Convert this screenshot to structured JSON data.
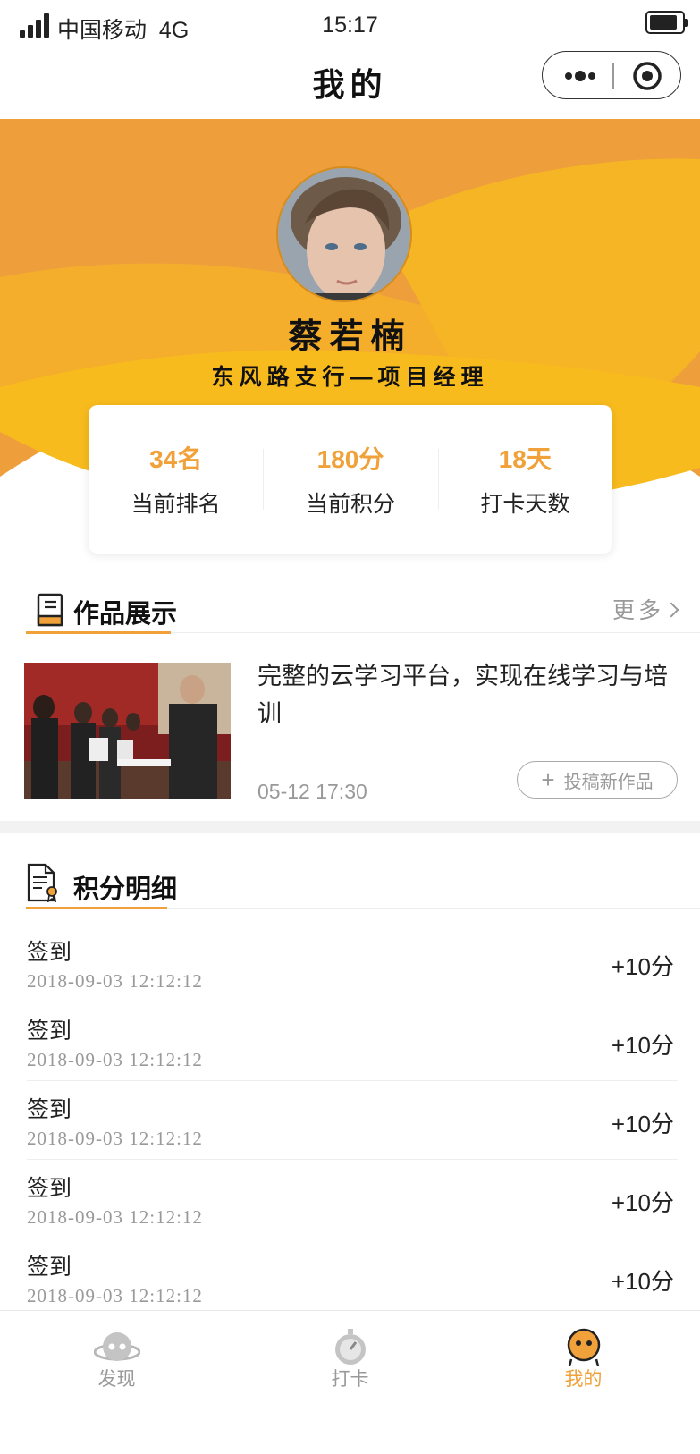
{
  "status_bar": {
    "carrier": "中国移动",
    "network": "4G",
    "time": "15:17"
  },
  "nav": {
    "title": "我的"
  },
  "profile": {
    "name": "蔡若楠",
    "title": "东风路支行—项目经理"
  },
  "stats": [
    {
      "value": "34名",
      "label": "当前排名"
    },
    {
      "value": "180分",
      "label": "当前积分"
    },
    {
      "value": "18天",
      "label": "打卡天数"
    }
  ],
  "works_section": {
    "title": "作品展示",
    "more_label": "更多",
    "item": {
      "title": "完整的云学习平台，实现在线学习与培训",
      "time": "05-12  17:30"
    },
    "submit_label": "投稿新作品"
  },
  "points_section": {
    "title": "积分明细",
    "items": [
      {
        "type": "签到",
        "date": "2018-09-03 12:12:12",
        "value": "+10分"
      },
      {
        "type": "签到",
        "date": "2018-09-03 12:12:12",
        "value": "+10分"
      },
      {
        "type": "签到",
        "date": "2018-09-03 12:12:12",
        "value": "+10分"
      },
      {
        "type": "签到",
        "date": "2018-09-03 12:12:12",
        "value": "+10分"
      },
      {
        "type": "签到",
        "date": "2018-09-03 12:12:12",
        "value": "+10分"
      }
    ]
  },
  "tabs": [
    {
      "label": "发现",
      "icon": "planet-icon",
      "active": false
    },
    {
      "label": "打卡",
      "icon": "stopwatch-icon",
      "active": false
    },
    {
      "label": "我的",
      "icon": "profile-face-icon",
      "active": true
    }
  ],
  "colors": {
    "accent": "#f0a13a",
    "banner_dark": "#ee9e3b",
    "banner_light": "#f8bb1e"
  }
}
